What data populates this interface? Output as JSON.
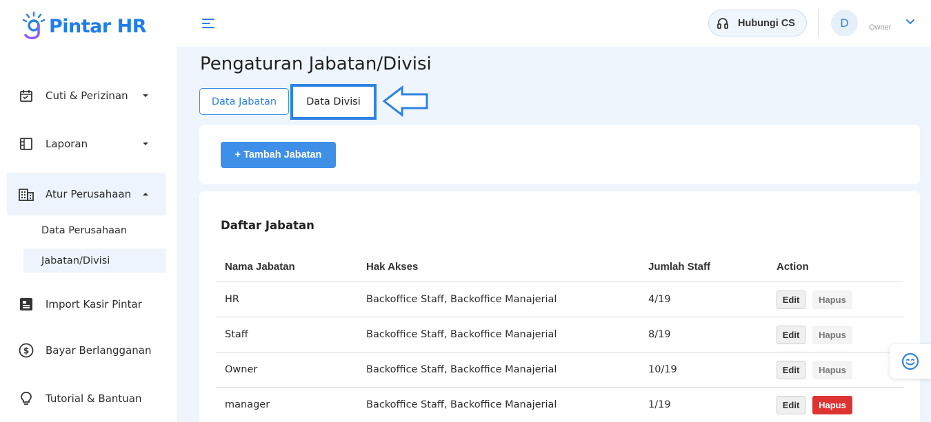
{
  "app": {
    "logo_text": "Pintar HR"
  },
  "sidebar": {
    "items": [
      {
        "label": "Cuti & Perizinan",
        "icon": "calendar-check-icon"
      },
      {
        "label": "Laporan",
        "icon": "document-icon"
      },
      {
        "label": "Atur Perusahaan",
        "icon": "building-icon"
      },
      {
        "label": "Import Kasir Pintar",
        "icon": "import-icon"
      },
      {
        "label": "Bayar Berlangganan",
        "icon": "dollar-icon"
      },
      {
        "label": "Tutorial & Bantuan",
        "icon": "lightbulb-icon"
      }
    ],
    "sub_items": [
      {
        "label": "Data Perusahaan"
      },
      {
        "label": "Jabatan/Divisi"
      }
    ]
  },
  "header": {
    "cs_label": "Hubungi CS",
    "avatar_initial": "D",
    "role": "Owner"
  },
  "page": {
    "title": "Pengaturan Jabatan/Divisi",
    "tabs": [
      {
        "label": "Data Jabatan"
      },
      {
        "label": "Data Divisi"
      }
    ],
    "add_button": "+ Tambah Jabatan",
    "list_title": "Daftar Jabatan"
  },
  "table": {
    "headers": [
      "Nama Jabatan",
      "Hak Akses",
      "Jumlah Staff",
      "Action"
    ],
    "rows": [
      {
        "name": "HR",
        "access": "Backoffice Staff, Backoffice Manajerial",
        "staff": "4/19",
        "edit": "Edit",
        "delete": "Hapus"
      },
      {
        "name": "Staff",
        "access": "Backoffice Staff, Backoffice Manajerial",
        "staff": "8/19",
        "edit": "Edit",
        "delete": "Hapus"
      },
      {
        "name": "Owner",
        "access": "Backoffice Staff, Backoffice Manajerial",
        "staff": "10/19",
        "edit": "Edit",
        "delete": "Hapus"
      },
      {
        "name": "manager",
        "access": "Backoffice Staff, Backoffice Manajerial",
        "staff": "1/19",
        "edit": "Edit",
        "delete": "Hapus"
      }
    ]
  },
  "colors": {
    "accent": "#2d82e2",
    "danger": "#de3431",
    "background": "#eef5fd"
  }
}
